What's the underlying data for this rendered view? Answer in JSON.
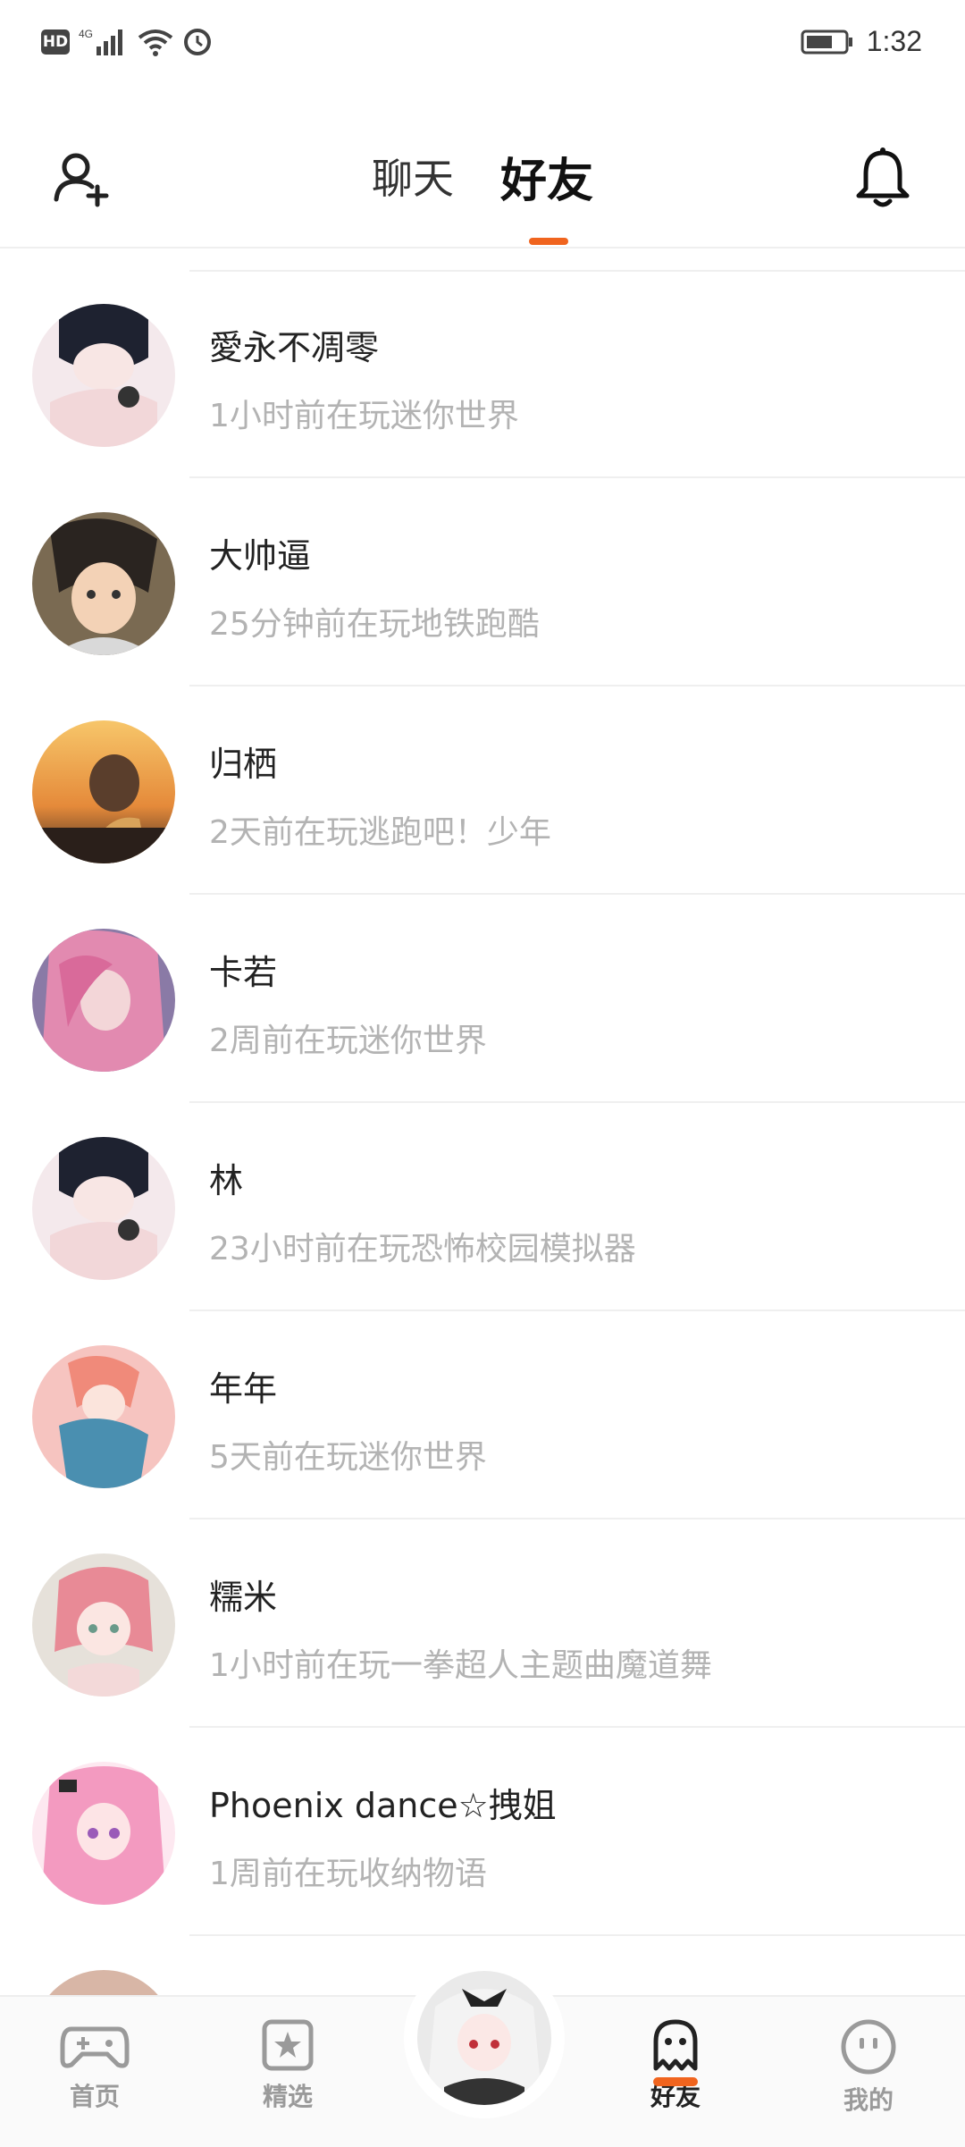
{
  "status_bar": {
    "network": "HD",
    "signal": "4G",
    "time": "1:32"
  },
  "header": {
    "tabs": [
      {
        "label": "聊天",
        "active": false
      },
      {
        "label": "好友",
        "active": true
      }
    ],
    "accent_color": "#f0641e"
  },
  "friends": [
    {
      "name": "愛永不凋零",
      "status": "1小时前在玩迷你世界"
    },
    {
      "name": "大帅逼",
      "status": "25分钟前在玩地铁跑酷"
    },
    {
      "name": "归栖",
      "status": "2天前在玩逃跑吧！少年"
    },
    {
      "name": "卡若",
      "status": "2周前在玩迷你世界"
    },
    {
      "name": "林",
      "status": "23小时前在玩恐怖校园模拟器"
    },
    {
      "name": "年年",
      "status": "5天前在玩迷你世界"
    },
    {
      "name": "糯米",
      "status": "1小时前在玩一拳超人主题曲魔道舞"
    },
    {
      "name": "Phoenix dance☆拽姐",
      "status": "1周前在玩收纳物语"
    }
  ],
  "bottom_nav": {
    "items": [
      {
        "label": "首页",
        "icon": "gamepad-icon"
      },
      {
        "label": "精选",
        "icon": "star-icon"
      },
      {
        "label": "好友",
        "icon": "ghost-icon",
        "active": true
      },
      {
        "label": "我的",
        "icon": "face-icon"
      }
    ]
  }
}
